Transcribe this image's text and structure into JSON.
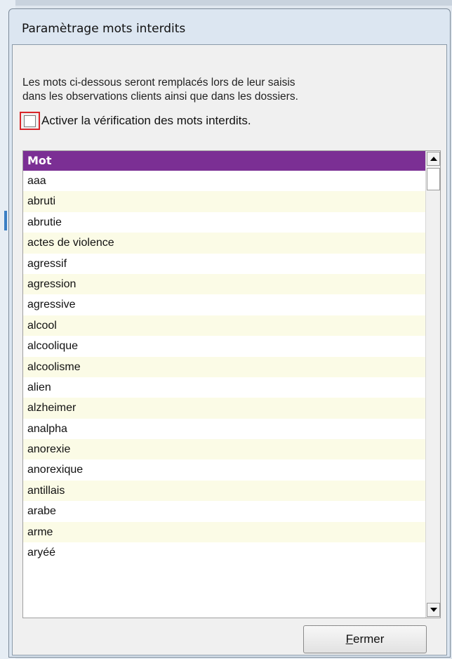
{
  "window": {
    "title": "Paramètrage mots interdits"
  },
  "description": {
    "line1": "Les mots ci-dessous seront remplacés lors de leur saisis",
    "line2": "dans les observations clients ainsi que dans les dossiers."
  },
  "checkbox": {
    "label": "Activer la vérification des mots interdits.",
    "checked": false
  },
  "grid": {
    "column_header": "Mot",
    "rows": [
      "aaa",
      "abruti",
      "abrutie",
      "actes de violence",
      "agressif",
      "agression",
      "agressive",
      "alcool",
      "alcoolique",
      "alcoolisme",
      "alien",
      "alzheimer",
      "analpha",
      "anorexie",
      "anorexique",
      "antillais",
      "arabe",
      "arme",
      "aryéé"
    ],
    "header_color": "#7b2f94",
    "alt_row_color": "#fbfbe6"
  },
  "buttons": {
    "close_mnemonic": "F",
    "close_rest": "ermer"
  },
  "highlight_color": "#d8262a"
}
